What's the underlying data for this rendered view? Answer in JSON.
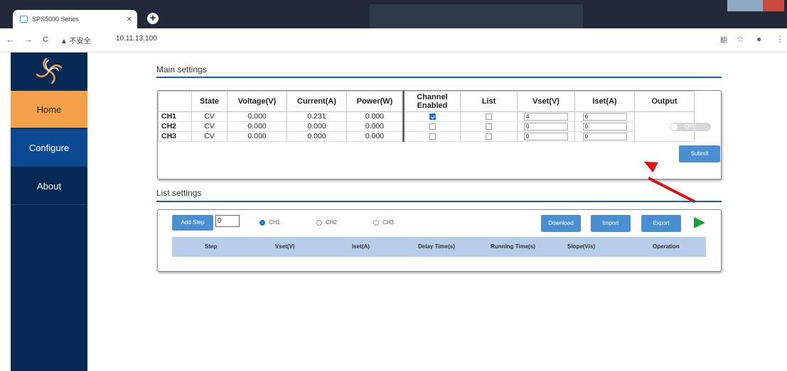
{
  "browser": {
    "tab_title": "SPS5000 Series",
    "tab_close": "×",
    "new_tab": "+",
    "nav_back": "←",
    "nav_forward": "→",
    "nav_reload": "C",
    "security_warning": "▲ 不安全",
    "url": "10.11.13.100",
    "right_icons": [
      "翻",
      "☆",
      "●",
      "⋮"
    ]
  },
  "sidebar": {
    "items": [
      {
        "label": "Home",
        "active": true
      },
      {
        "label": "Configure"
      },
      {
        "label": "About"
      }
    ]
  },
  "main_settings": {
    "title": "Main settings",
    "columns": [
      "",
      "State",
      "Voltage(V)",
      "Current(A)",
      "Power(W)",
      "Channel Enabled",
      "List",
      "Vset(V)",
      "Iset(A)",
      "Output"
    ],
    "rows": [
      {
        "ch": "CH1",
        "state": "CV",
        "voltage": "0.000",
        "current": "0.231",
        "power": "0.000",
        "enabled": true,
        "list": false,
        "vset": "4",
        "iset": "6"
      },
      {
        "ch": "CH2",
        "state": "CV",
        "voltage": "0.000",
        "current": "0.000",
        "power": "0.000",
        "enabled": false,
        "list": false,
        "vset": "0",
        "iset": "0"
      },
      {
        "ch": "CH3",
        "state": "CV",
        "voltage": "0.000",
        "current": "0.000",
        "power": "0.000",
        "enabled": false,
        "list": false,
        "vset": "0",
        "iset": "0"
      }
    ],
    "output_toggle": "OFF",
    "submit_label": "Submit"
  },
  "list_settings": {
    "title": "List settings",
    "add_step_label": "Add Step",
    "step_count": "0",
    "channels": [
      {
        "label": "CH1",
        "selected": true
      },
      {
        "label": "CH2",
        "selected": false
      },
      {
        "label": "CH3",
        "selected": false
      }
    ],
    "download_label": "Download",
    "import_label": "Import",
    "export_label": "Export",
    "columns": [
      "Step",
      "Vset(V)",
      "Iset(A)",
      "Delay Time(s)",
      "Running Time(s)",
      "Slope(V/s)",
      "Operation"
    ]
  },
  "colors": {
    "sidebar_bg": "#072a55",
    "home_active": "#f5a14a",
    "configure_bg": "#0a4a92",
    "button_blue": "#4a8fd1",
    "rule_blue": "#1f5b96",
    "play_green": "#1e9e3a",
    "annotation_arrow": "#e01010"
  }
}
